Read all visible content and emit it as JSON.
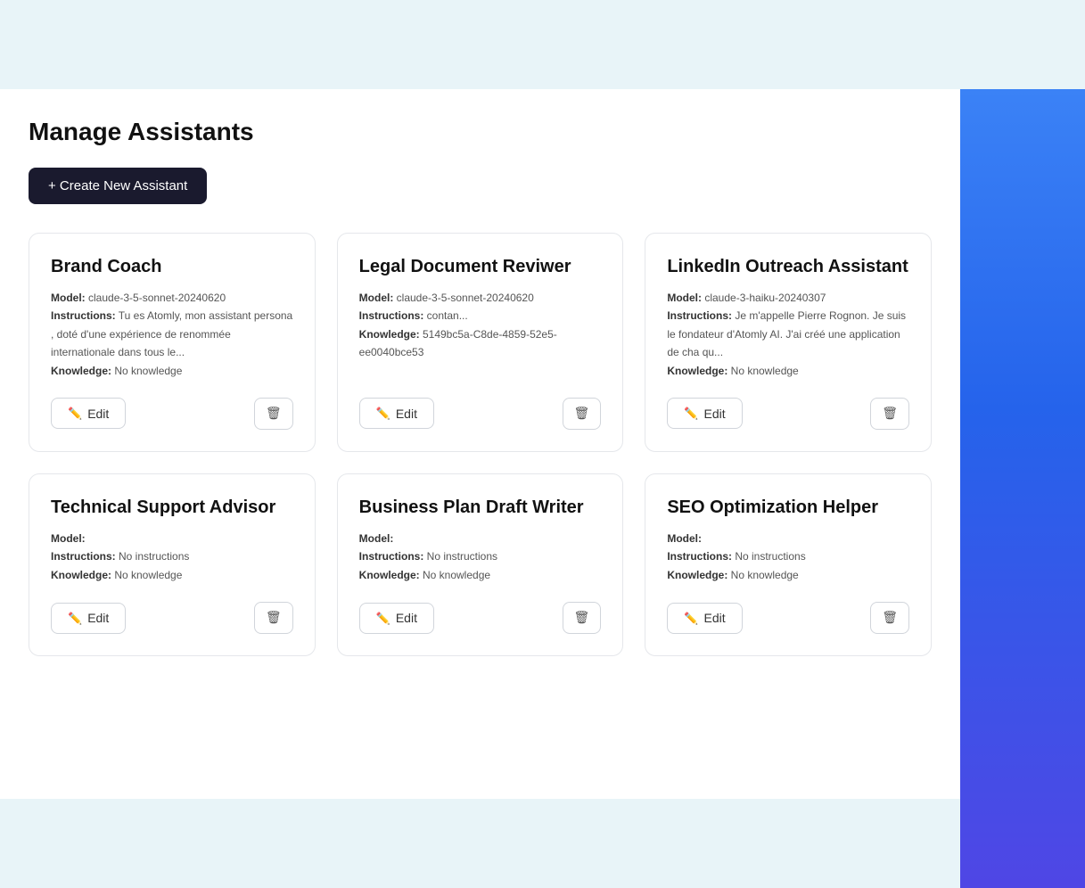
{
  "page": {
    "title": "Manage Assistants",
    "create_button": "+ Create New Assistant"
  },
  "assistants": [
    {
      "id": "brand-coach",
      "name": "Brand Coach",
      "model": "claude-3-5-sonnet-20240620",
      "instructions": "Tu es Atomly, mon assistant persona , doté d'une expérience de renommée internationale dans tous le...",
      "knowledge": "No knowledge"
    },
    {
      "id": "legal-document-reviwer",
      "name": "Legal Document Reviwer",
      "model": "claude-3-5-sonnet-20240620",
      "instructions": "contan...",
      "knowledge": "5149bc5a-C8de-4859-52e5-ee0040bce53"
    },
    {
      "id": "linkedin-outreach-assistant",
      "name": "LinkedIn Outreach Assistant",
      "model": "claude-3-haiku-20240307",
      "instructions": "Je m'appelle Pierre Rognon. Je suis le fondateur d'Atomly AI. J'ai créé une application de cha qu...",
      "knowledge": "No knowledge"
    },
    {
      "id": "technical-support-advisor",
      "name": "Technical Support Advisor",
      "model": "",
      "instructions": "No instructions",
      "knowledge": "No knowledge"
    },
    {
      "id": "business-plan-draft-writer",
      "name": "Business Plan Draft Writer",
      "model": "",
      "instructions": "No instructions",
      "knowledge": "No knowledge"
    },
    {
      "id": "seo-optimization-helper",
      "name": "SEO Optimization Helper",
      "model": "",
      "instructions": "No instructions",
      "knowledge": "No knowledge"
    }
  ],
  "labels": {
    "model": "Model:",
    "instructions": "Instructions:",
    "knowledge": "Knowledge:",
    "edit": "Edit",
    "no_model": ""
  }
}
